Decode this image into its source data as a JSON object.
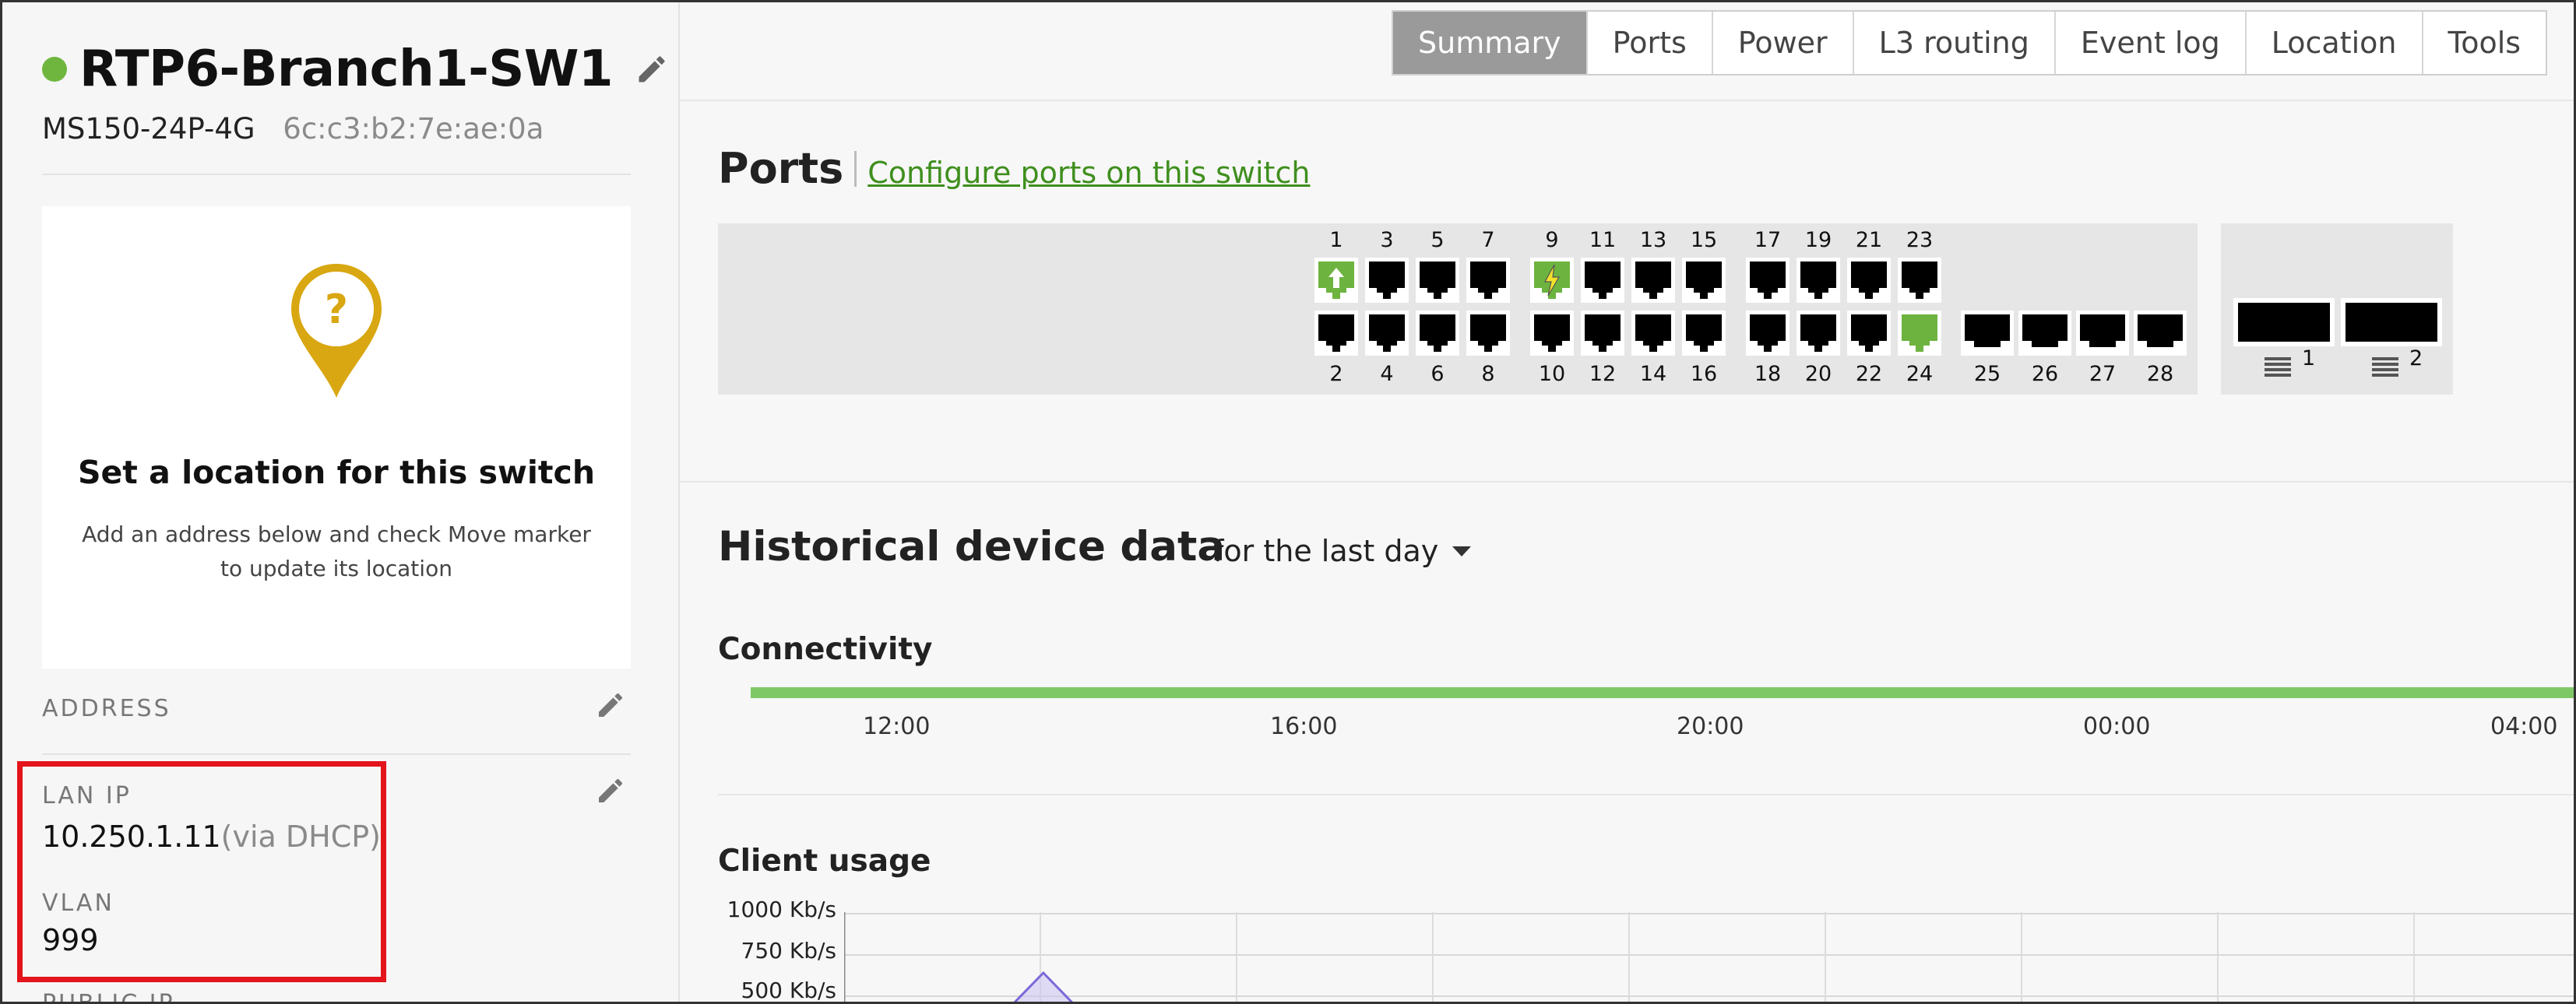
{
  "device": {
    "name": "RTP6-Branch1-SW1",
    "status_color": "#6fb63e",
    "model": "MS150-24P-4G",
    "mac": "6c:c3:b2:7e:ae:0a"
  },
  "location_card": {
    "icon": "location-pin-question-icon",
    "title": "Set a location for this switch",
    "description": "Add an address below and check Move marker to update its location"
  },
  "address": {
    "label": "ADDRESS",
    "edit_icon": "pencil-icon"
  },
  "lan_ip": {
    "label": "LAN IP",
    "value": "10.250.1.11",
    "note": "(via DHCP)"
  },
  "vlan": {
    "label": "VLAN",
    "value": "999"
  },
  "public_ip": {
    "label": "PUBLIC IP"
  },
  "tabs": [
    {
      "label": "Summary",
      "active": true
    },
    {
      "label": "Ports",
      "active": false
    },
    {
      "label": "Power",
      "active": false
    },
    {
      "label": "L3 routing",
      "active": false
    },
    {
      "label": "Event log",
      "active": false
    },
    {
      "label": "Location",
      "active": false
    },
    {
      "label": "Tools",
      "active": false
    }
  ],
  "ports": {
    "title": "Ports",
    "configure_link": "Configure ports on this switch",
    "top_numbers": [
      "1",
      "3",
      "5",
      "7",
      "9",
      "11",
      "13",
      "15",
      "17",
      "19",
      "21",
      "23"
    ],
    "bottom_numbers": [
      "2",
      "4",
      "6",
      "8",
      "10",
      "12",
      "14",
      "16",
      "18",
      "20",
      "22",
      "24"
    ],
    "uplink_numbers": [
      "25",
      "26",
      "27",
      "28"
    ],
    "sfp_numbers": [
      "1",
      "2"
    ],
    "status": {
      "1": "uplink",
      "9": "poe",
      "24": "connected"
    },
    "colors": {
      "active": "#6db33f",
      "idle": "#000000"
    }
  },
  "history": {
    "title": "Historical device data",
    "range": "for the last day",
    "connectivity": {
      "title": "Connectivity",
      "ticks": [
        "12:00",
        "16:00",
        "20:00",
        "00:00",
        "04:00"
      ],
      "color": "#7fc866"
    },
    "client_usage": {
      "title": "Client usage",
      "y_ticks": [
        "1000 Kb/s",
        "750 Kb/s",
        "500 Kb/s"
      ]
    }
  },
  "chart_data": {
    "type": "area",
    "title": "Client usage",
    "y_ticks": [
      "1000 Kb/s",
      "750 Kb/s",
      "500 Kb/s"
    ],
    "ylim": [
      500,
      1000
    ],
    "grid": true,
    "series": [
      {
        "x_fraction": [
          0.0,
          0.08,
          0.115,
          0.15,
          0.3,
          1.0
        ],
        "values": [
          0,
          0,
          500,
          0,
          0,
          0
        ]
      }
    ]
  }
}
